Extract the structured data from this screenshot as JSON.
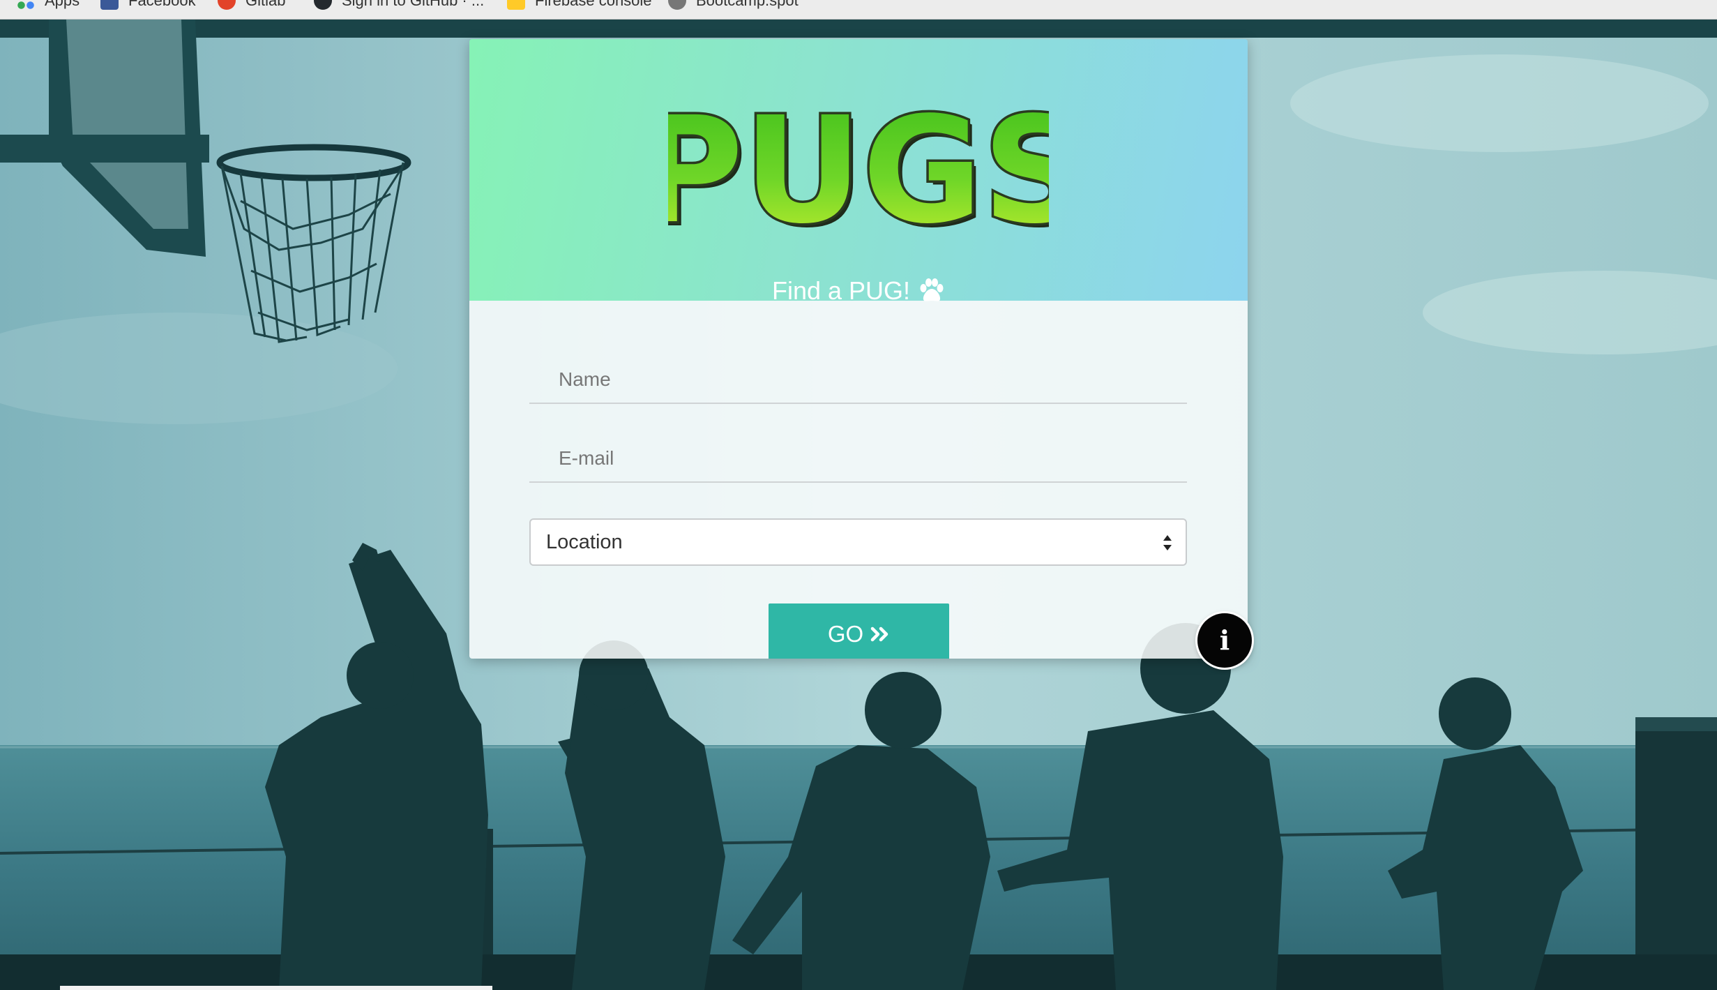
{
  "browser": {
    "bookmarks": [
      {
        "label": "Apps",
        "icon": "apps-icon"
      },
      {
        "label": "Facebook",
        "icon": "facebook-icon"
      },
      {
        "label": "Gitlab",
        "icon": "gitlab-icon"
      },
      {
        "label": "Sign in to GitHub · ...",
        "icon": "github-icon"
      },
      {
        "label": "Firebase console",
        "icon": "firebase-icon"
      },
      {
        "label": "Bootcamp.spot",
        "icon": "bootcamp-icon"
      }
    ]
  },
  "header": {
    "logo_text": "PUGS",
    "tagline": "Find a PUG!",
    "tagline_icon": "paw-icon"
  },
  "form": {
    "name_placeholder": "Name",
    "email_placeholder": "E-mail",
    "location_value": "Location",
    "go_label": "GO",
    "go_icon": "double-chevron-right-icon"
  },
  "info_button": {
    "glyph": "i",
    "icon": "info-icon"
  },
  "colors": {
    "header_gradient_start": "#86f2b6",
    "header_gradient_end": "#8dd4ee",
    "go_button": "#2fb7a6",
    "logo_green": "#5cd321",
    "info_button": "#050505"
  }
}
